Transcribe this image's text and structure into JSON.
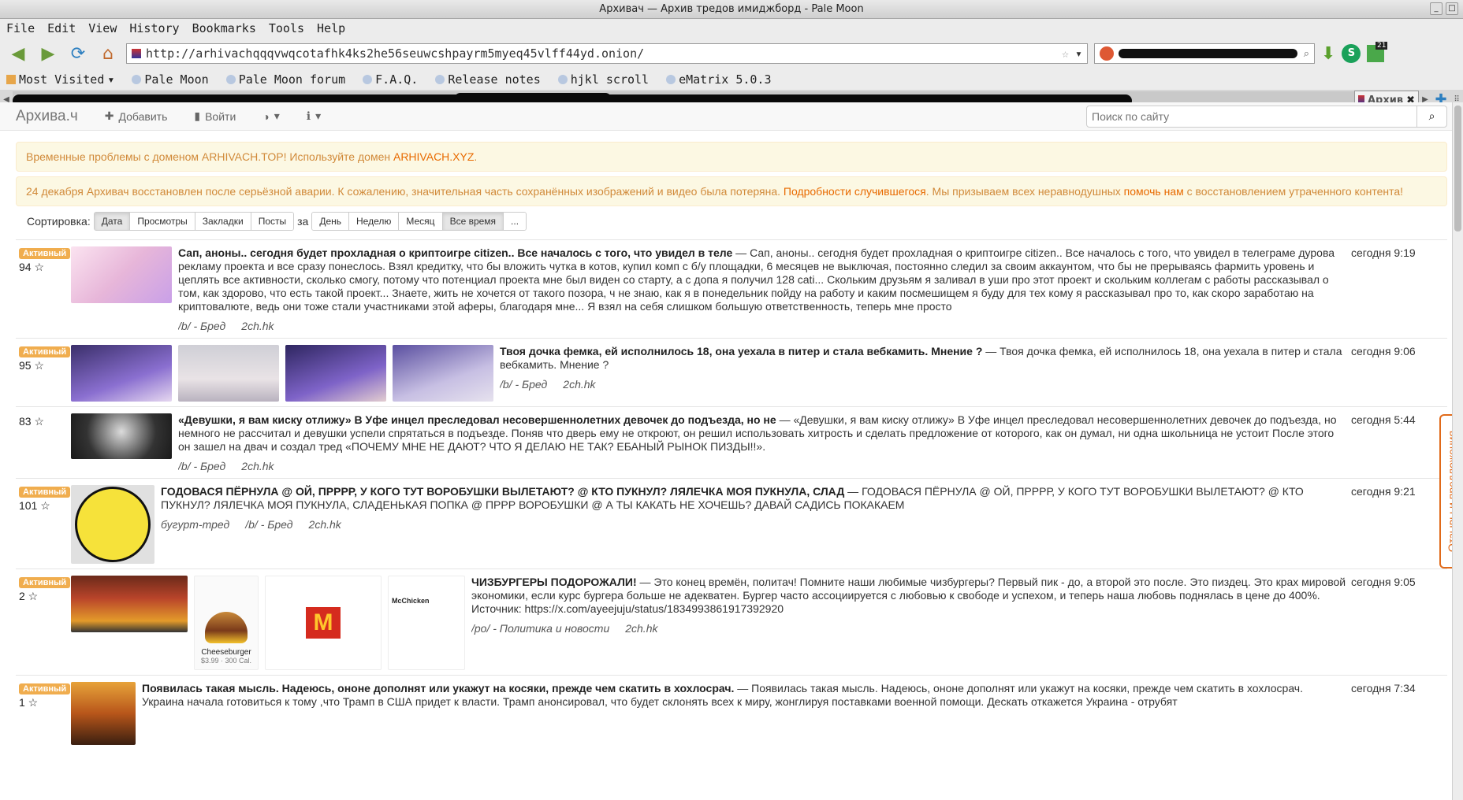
{
  "window": {
    "title": "Архивач — Архив тредов имиджборд - Pale Moon"
  },
  "menu": [
    "File",
    "Edit",
    "View",
    "History",
    "Bookmarks",
    "Tools",
    "Help"
  ],
  "navbar": {
    "url": "http://arhivachqqqvwqcotafhk4ks2he56seuwcshpayrm5myeq45vlff44yd.onion/",
    "badge_count": "21"
  },
  "bookmarks": [
    "Most Visited",
    "Pale Moon",
    "Pale Moon forum",
    "F.A.Q.",
    "Release notes",
    "hjkl scroll",
    "eMatrix 5.0.3"
  ],
  "active_tab": {
    "label": "Архив"
  },
  "site": {
    "brand": "Архива.ч",
    "nav_add": "Добавить",
    "nav_login": "Войти",
    "search_placeholder": "Поиск по сайту"
  },
  "alerts": {
    "a1_text": "Временные проблемы с доменом ARHIVACH.TOP! Используйте домен ",
    "a1_link": "ARHIVACH.XYZ",
    "a1_end": ".",
    "a2_text": "24 декабря Архивач восстановлен после серьёзной аварии. К сожалению, значительная часть сохранённых изображений и видео была потеряна. ",
    "a2_link1": "Подробности случившегося",
    "a2_mid": ". Мы призываем всех неравнодушных ",
    "a2_link2": "помочь нам",
    "a2_end": " с восстановлением утраченного контента!"
  },
  "sort": {
    "label": "Сортировка:",
    "by": [
      "Дата",
      "Просмотры",
      "Закладки",
      "Посты"
    ],
    "za": "за",
    "period": [
      "День",
      "Неделю",
      "Месяц",
      "Все время",
      "..."
    ]
  },
  "threads": [
    {
      "active": "Активный",
      "rating": "94 ☆",
      "title": "Сап, аноны.. сегодня будет прохладная о криптоигре citizen.. Все началось с того, что увидел в теле",
      "text": " — Сап, аноны.. сегодня будет прохладная о криптоигре citizen.. Все началось с того, что увидел в телеграме дурова рекламу проекта и все сразу понеслось. Взял кредитку, что бы вложить чутка в котов, купил комп с б/у площадки, 6 месяцев не выключая, постоянно следил за своим аккаунтом, что бы не прерываясь фармить уровень и цеплять все активности, сколько смогу, потому что потенциал проекта мне был виден со старту, а с допа я получил 128 cati... Скольким друзьям я заливал в уши про этот проект и скольким коллегам с работы рассказывал о том, как здорово, что есть такой проект... Знаете, жить не хочется от такого позора, ч не знаю, как я в понедельник пойду на работу и каким посмешищем я буду для тех кому я рассказывал про то, как скоро заработаю на криптовалюте, ведь они тоже стали участниками этой аферы, благодаря мне... Я взял на себя слишком большую ответственность, теперь мне просто",
      "tags": [
        "/b/ - Бред",
        "2ch.hk"
      ],
      "time": "сегодня 9:19"
    },
    {
      "active": "Активный",
      "rating": "95 ☆",
      "title": "Твоя дочка фемка, ей исполнилось 18, она уехала в питер и стала вебкамить. Мнение ?",
      "text": " — Твоя дочка фемка, ей исполнилось 18, она уехала в питер и стала вебкамить. Мнение ?",
      "tags": [
        "/b/ - Бред",
        "2ch.hk"
      ],
      "time": "сегодня 9:06"
    },
    {
      "active": "",
      "rating": "83 ☆",
      "title": "«Девушки, я вам киску отлижу» В Уфе инцел преследовал несовершеннолетних девочек до подъезда, но не",
      "text": " — «Девушки, я вам киску отлижу» В Уфе инцел преследовал несовершеннолетних девочек до подъезда, но немного не рассчитал и девушки успели спрятаться в подъезде. Поняв что дверь ему не откроют, он решил использовать хитрость и сделать предложение от которого, как он думал, ни одна школьница не устоит После этого он зашел на двач и создал тред «ПОЧЕМУ МНЕ НЕ ДАЮТ? ЧТО Я ДЕЛАЮ НЕ ТАК? ЕБАНЫЙ РЫНОК ПИЗДЫ!!».",
      "tags": [
        "/b/ - Бред",
        "2ch.hk"
      ],
      "time": "сегодня 5:44"
    },
    {
      "active": "Активный",
      "rating": "101 ☆",
      "title": "ГОДОВАСЯ ПЁРНУЛА @ ОЙ, ПРРРР, У КОГО ТУТ ВОРОБУШКИ ВЫЛЕТАЮТ? @ КТО ПУКНУЛ? ЛЯЛЕЧКА МОЯ ПУКНУЛА, СЛАД",
      "text": " — ГОДОВАСЯ ПЁРНУЛА @ ОЙ, ПРРРР, У КОГО ТУТ ВОРОБУШКИ ВЫЛЕТАЮТ? @ КТО ПУКНУЛ? ЛЯЛЕЧКА МОЯ ПУКНУЛА, СЛАДЕНЬКАЯ ПОПКА @ ПРРР ВОРОБУШКИ @ А ТЫ КАКАТЬ НЕ ХОЧЕШЬ? ДАВАЙ САДИСЬ ПОКАКАЕМ",
      "tags": [
        "бугурт-тред",
        "/b/ - Бред",
        "2ch.hk"
      ],
      "time": "сегодня 9:21"
    },
    {
      "active": "Активный",
      "rating": "2 ☆",
      "title": "ЧИЗБУРГЕРЫ ПОДОРОЖАЛИ!",
      "text": " — Это конец времён, политач! Помните наши любимые чизбургеры? Первый пик - до, а второй это после. Это пиздец. Это крах мировой экономики, если курс бургера больше не адекватен. Бургер часто ассоциируется с любовью к свободе и успехом, и теперь наша любовь поднялась в цене до 400%. Источник: https://x.com/ayeejuju/status/1834993861917392920",
      "tags": [
        "/po/ - Политика и новости",
        "2ch.hk"
      ],
      "time": "сегодня 9:05"
    },
    {
      "active": "Активный",
      "rating": "1 ☆",
      "title": "Появилась такая мысль. Надеюсь, ононе дополнят или укажут на косяки, прежде чем скатить в хохлосрач.",
      "text": " — Появилась такая мысль. Надеюсь, ононе дополнят или укажут на косяки, прежде чем скатить в хохлосрач. Украина начала готовиться к тому ,что Трамп в США придет к власти. Трамп анонсировал, что будет склонять всех к миру, жонглируя поставками военной помощи. Дескать откажется Украина - отрубят",
      "tags": [],
      "time": "сегодня 7:34"
    }
  ],
  "thumb_labels": {
    "cheeseburger": "Cheeseburger",
    "cheeseburger_price": "$3.99 · 300 Cal.",
    "mcchicken": "McChicken"
  },
  "feedback": "Отзывы и предложения"
}
